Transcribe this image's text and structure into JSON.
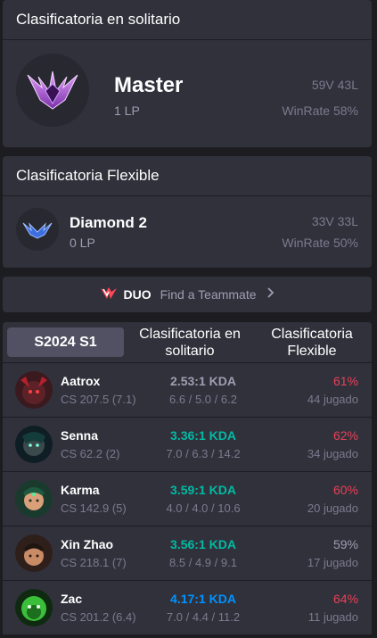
{
  "solo": {
    "title": "Clasificatoria en solitario",
    "tier": "Master",
    "lp": "1 LP",
    "win_loss": "59V 43L",
    "winrate": "WinRate 58%"
  },
  "flex": {
    "title": "Clasificatoria Flexible",
    "tier": "Diamond 2",
    "lp": "0 LP",
    "win_loss": "33V 33L",
    "winrate": "WinRate 50%"
  },
  "duo": {
    "label": "DUO",
    "text": "Find a Teammate"
  },
  "tabs": [
    {
      "label": "S2024 S1",
      "active": true
    },
    {
      "label": "Clasificatoria en solitario",
      "active": false
    },
    {
      "label": "Clasificatoria Flexible",
      "active": false
    }
  ],
  "champions": [
    {
      "name": "Aatrox",
      "cs": "CS 207.5 (7.1)",
      "kda": "2.53:1 KDA",
      "kda_detail": "6.6 / 5.0 / 6.2",
      "winrate": "61%",
      "played": "44 jugado",
      "kda_color": "#9e9eb1",
      "wr_color": "#e84057"
    },
    {
      "name": "Senna",
      "cs": "CS 62.2 (2)",
      "kda": "3.36:1 KDA",
      "kda_detail": "7.0 / 6.3 / 14.2",
      "winrate": "62%",
      "played": "34 jugado",
      "kda_color": "#00bba3",
      "wr_color": "#e84057"
    },
    {
      "name": "Karma",
      "cs": "CS 142.9 (5)",
      "kda": "3.59:1 KDA",
      "kda_detail": "4.0 / 4.0 / 10.6",
      "winrate": "60%",
      "played": "20 jugado",
      "kda_color": "#00bba3",
      "wr_color": "#e84057"
    },
    {
      "name": "Xin Zhao",
      "cs": "CS 218.1 (7)",
      "kda": "3.56:1 KDA",
      "kda_detail": "8.5 / 4.9 / 9.1",
      "winrate": "59%",
      "played": "17 jugado",
      "kda_color": "#00bba3",
      "wr_color": "#9e9eb1"
    },
    {
      "name": "Zac",
      "cs": "CS 201.2 (6.4)",
      "kda": "4.17:1 KDA",
      "kda_detail": "7.0 / 4.4 / 11.2",
      "winrate": "64%",
      "played": "11 jugado",
      "kda_color": "#0093ff",
      "wr_color": "#e84057"
    }
  ]
}
